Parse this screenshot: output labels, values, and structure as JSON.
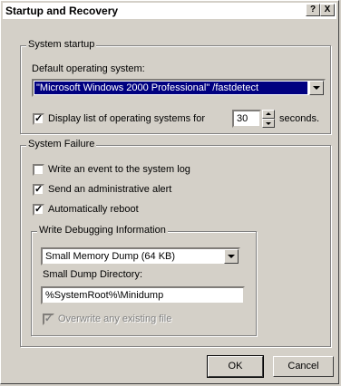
{
  "window": {
    "title": "Startup and Recovery",
    "help_label": "?",
    "close_label": "X"
  },
  "system_startup": {
    "legend": "System startup",
    "default_os_label": "Default operating system:",
    "default_os_value": "\"Microsoft Windows 2000 Professional\" /fastdetect",
    "display_list_label": "Display list of operating systems for",
    "display_list_checked": true,
    "seconds_value": "30",
    "seconds_label": "seconds."
  },
  "system_failure": {
    "legend": "System Failure",
    "options": [
      {
        "label": "Write an event to the system log",
        "checked": false
      },
      {
        "label": "Send an administrative alert",
        "checked": true
      },
      {
        "label": "Automatically reboot",
        "checked": true
      }
    ],
    "debug": {
      "legend": "Write Debugging Information",
      "dump_type_value": "Small Memory Dump (64 KB)",
      "dump_dir_label": "Small Dump Directory:",
      "dump_dir_value": "%SystemRoot%\\Minidump",
      "overwrite_label": "Overwrite any existing file",
      "overwrite_checked": true,
      "overwrite_enabled": false
    }
  },
  "buttons": {
    "ok": "OK",
    "cancel": "Cancel"
  }
}
